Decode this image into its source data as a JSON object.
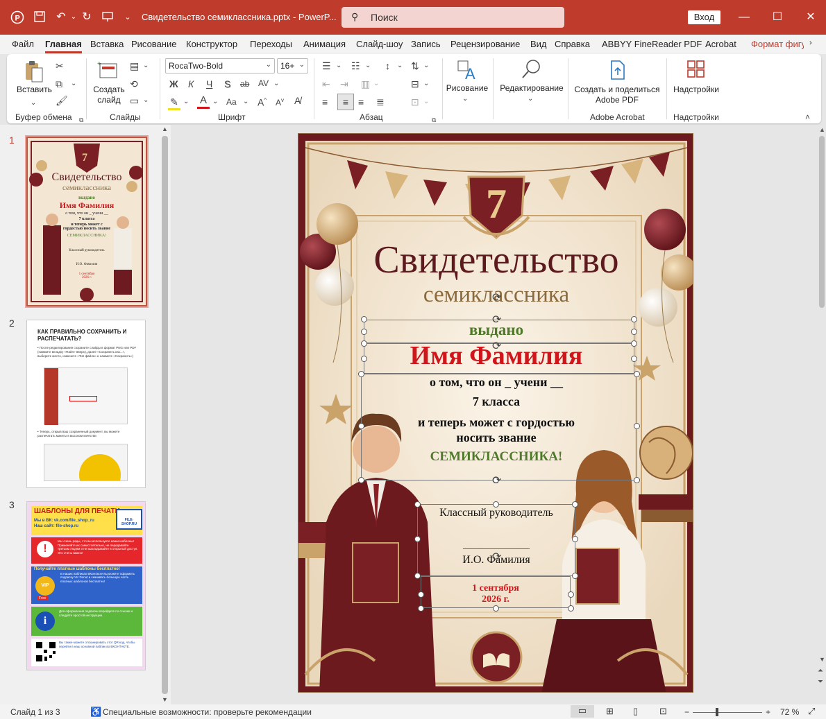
{
  "titlebar": {
    "doc_title": "Свидетельство семиклассника.pptx  -  PowerP...",
    "search_placeholder": "Поиск",
    "signin": "Вход"
  },
  "menu": {
    "tabs": [
      "Файл",
      "Главная",
      "Вставка",
      "Рисование",
      "Конструктор",
      "Переходы",
      "Анимация",
      "Слайд-шоу",
      "Запись",
      "Рецензирование",
      "Вид",
      "Справка",
      "ABBYY FineReader PDF",
      "Acrobat",
      "Формат фигу"
    ],
    "active": "Главная"
  },
  "ribbon": {
    "paste": "Вставить",
    "new_slide": "Создать слайд",
    "font_name": "RocaTwo-Bold",
    "font_size": "16+",
    "drawing": "Рисование",
    "editing": "Редактирование",
    "adobe_create": "Создать и поделиться Adobe PDF",
    "addins": "Надстройки",
    "groups": {
      "clipboard": "Буфер обмена",
      "slides": "Слайды",
      "font": "Шрифт",
      "paragraph": "Абзац",
      "adobe": "Adobe Acrobat",
      "addins": "Надстройки"
    },
    "bold": "Ж",
    "italic": "К",
    "underline": "Ч",
    "shadow": "S",
    "strike": "ab",
    "case": "Aa"
  },
  "thumbnails": {
    "nums": [
      "1",
      "2",
      "3"
    ],
    "t1": {
      "title": "Свидетельство",
      "sub": "семиклассника",
      "issued": "выдано",
      "name": "Имя Фамилия",
      "line1": "о том, что он _ учени __",
      "line2": "7 класса",
      "line3": "и теперь может с гордостью носить звание",
      "line4": "СЕМИКЛАССНИКА!",
      "teacher": "Классный руководитель",
      "initials": "И.О. Фамилия",
      "date": "1 сентября 2026 г."
    },
    "t2": {
      "heading": "КАК ПРАВИЛЬНО СОХРАНИТЬ И РАСПЕЧАТАТЬ?",
      "p1": "• После редактирования сохраните слайды в формат PNG или PDF (нажмите вкладку «Файл» вверху, далее «Сохранить как...», выберите место, измените «Тип файла» и нажмите «Сохранить»)",
      "p2": "• Теперь, открыв ваш сохраненный документ, вы можете распечатать макеты в высоком качестве."
    },
    "t3": {
      "heading": "ШАБЛОНЫ ДЛЯ ПЕЧАТИ",
      "vk": "Мы в ВК: vk.com/file_shop_ru",
      "site": "Наш сайт: file-shop.ru",
      "logo": "FILE-SHOP.RU",
      "b1": "Мы очень рады, что вы используете наши шаблоны! Применяйте их самостоятельно, не передавайте третьим людям и не выкладывайте в открытый доступ. Это очень важно!",
      "b2": "Получайте платные шаблоны бесплатно!",
      "b2_text": "В наших пабликах ВКонтакте вы можете оформить подписку VK Donut и скачивать большую часть платных шаблонов бесплатно!",
      "vip": "VIP",
      "free": "Free",
      "b3": "Для оформления подписки перейдите по ссылке и следуйте простой инструкции.",
      "b4": "Вы также можете отсканировать этот QR-код, чтобы перейти в наш основной паблик во ВКОНТАКТЕ."
    }
  },
  "slide": {
    "badge": "7",
    "title": "Свидетельство",
    "subtitle": "семиклассника",
    "issued": "выдано",
    "name": "Имя Фамилия",
    "line1": "о том, что он _  учени __",
    "line2": "7 класса",
    "line3": "и теперь может с гордостью",
    "line4": "носить звание",
    "line5": "СЕМИКЛАССНИКА!",
    "teacher": "Классный руководитель",
    "signature_line": "________________",
    "initials": "И.О. Фамилия",
    "date1": "1 сентября",
    "date2": "2026 г."
  },
  "status": {
    "slide_of": "Слайд 1 из 3",
    "accessibility": "Специальные возможности: проверьте рекомендации",
    "zoom": "72 %",
    "minus": "−",
    "plus": "+"
  },
  "colors": {
    "accent": "#bf3b2c",
    "maroon": "#7a1f24",
    "red_text": "#d0161b",
    "green_text": "#4e7a2a",
    "gold": "#c9a36a"
  }
}
